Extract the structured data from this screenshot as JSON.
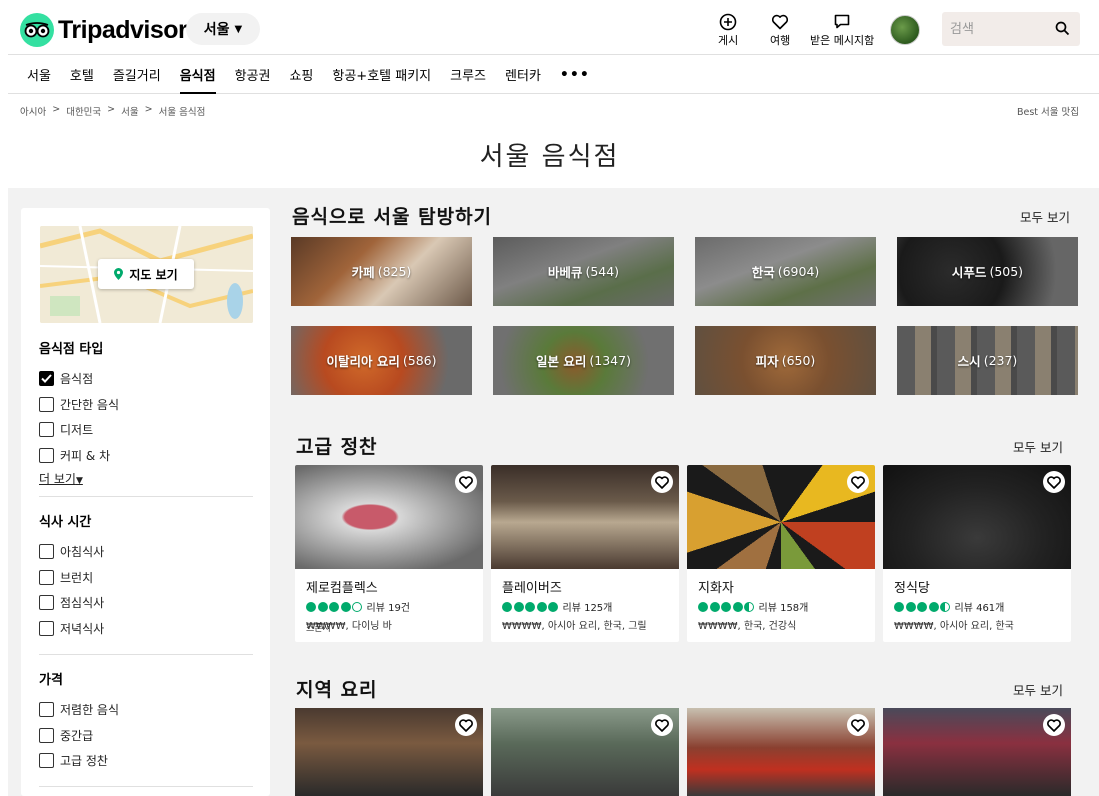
{
  "header": {
    "brand": "Tripadvisor",
    "location": "서울",
    "post_label": "게시",
    "trips_label": "여행",
    "inbox_label": "받은 메시지함",
    "search_placeholder": "검색"
  },
  "nav": {
    "items": [
      {
        "label": "서울"
      },
      {
        "label": "호텔"
      },
      {
        "label": "즐길거리"
      },
      {
        "label": "음식점",
        "active": true
      },
      {
        "label": "항공권"
      },
      {
        "label": "쇼핑"
      },
      {
        "label": "항공+호텔 패키지"
      },
      {
        "label": "크루즈"
      },
      {
        "label": "렌터카"
      }
    ],
    "more": "•••"
  },
  "breadcrumb": [
    "아시아",
    "대한민국",
    "서울",
    "서울 음식점"
  ],
  "breadcrumb_sep": ">",
  "best_link": "Best 서울 맛집",
  "page_title": "서울 음식점",
  "sidebar": {
    "map_button": "지도 보기",
    "restaurant_type": {
      "title": "음식점 타입",
      "options": [
        {
          "label": "음식점",
          "checked": true
        },
        {
          "label": "간단한 음식",
          "checked": false
        },
        {
          "label": "디저트",
          "checked": false
        },
        {
          "label": "커피 & 차",
          "checked": false
        }
      ],
      "more": "더 보기"
    },
    "meal_time": {
      "title": "식사 시간",
      "options": [
        {
          "label": "아침식사",
          "checked": false
        },
        {
          "label": "브런치",
          "checked": false
        },
        {
          "label": "점심식사",
          "checked": false
        },
        {
          "label": "저녁식사",
          "checked": false
        }
      ]
    },
    "price": {
      "title": "가격",
      "options": [
        {
          "label": "저렴한 음식",
          "checked": false
        },
        {
          "label": "중간급",
          "checked": false
        },
        {
          "label": "고급 정찬",
          "checked": false
        }
      ]
    }
  },
  "explore": {
    "title": "음식으로 서울 탐방하기",
    "see_all": "모두 보기",
    "categories": [
      {
        "name": "카페",
        "count": "(825)"
      },
      {
        "name": "바베큐",
        "count": "(544)"
      },
      {
        "name": "한국",
        "count": "(6904)"
      },
      {
        "name": "시푸드",
        "count": "(505)"
      },
      {
        "name": "이탈리아 요리",
        "count": "(586)"
      },
      {
        "name": "일본 요리",
        "count": "(1347)"
      },
      {
        "name": "피자",
        "count": "(650)"
      },
      {
        "name": "스시",
        "count": "(237)"
      }
    ]
  },
  "fine_dining": {
    "title": "고급 정찬",
    "see_all": "모두 보기",
    "cards": [
      {
        "name": "제로컴플렉스",
        "rating": 4.0,
        "reviews": "리뷰 19건",
        "meta": "₩₩₩₩, 다이닝 바",
        "tag": "스폰서"
      },
      {
        "name": "플레이버즈",
        "rating": 5.0,
        "reviews": "리뷰 125개",
        "meta": "₩₩₩₩, 아시아 요리, 한국, 그릴"
      },
      {
        "name": "지화자",
        "rating": 4.5,
        "reviews": "리뷰 158개",
        "meta": "₩₩₩₩, 한국, 건강식"
      },
      {
        "name": "정식당",
        "rating": 4.5,
        "reviews": "리뷰 461개",
        "meta": "₩₩₩₩, 아시아 요리, 한국"
      }
    ]
  },
  "local_food": {
    "title": "지역 요리",
    "see_all": "모두 보기"
  },
  "colors": {
    "brand_green": "#34e0a1",
    "rating_green": "#00aa6c",
    "page_gray": "#f2f2f2"
  }
}
